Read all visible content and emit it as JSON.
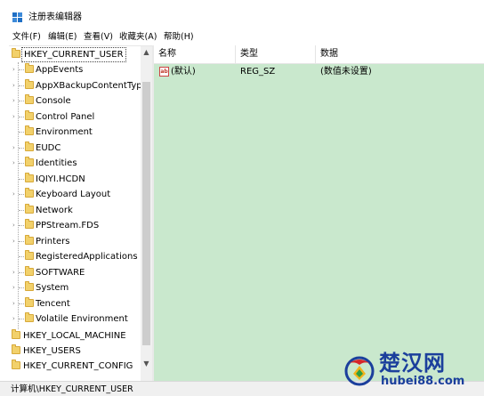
{
  "window": {
    "title": "注册表编辑器"
  },
  "menu": {
    "items": [
      "文件(F)",
      "编辑(E)",
      "查看(V)",
      "收藏夹(A)",
      "帮助(H)"
    ]
  },
  "tree": {
    "root": "HKEY_CURRENT_USER",
    "children": [
      {
        "label": "AppEvents",
        "expandable": true
      },
      {
        "label": "AppXBackupContentType",
        "expandable": true
      },
      {
        "label": "Console",
        "expandable": true
      },
      {
        "label": "Control Panel",
        "expandable": true
      },
      {
        "label": "Environment",
        "expandable": false
      },
      {
        "label": "EUDC",
        "expandable": true
      },
      {
        "label": "Identities",
        "expandable": true
      },
      {
        "label": "IQIYI.HCDN",
        "expandable": false
      },
      {
        "label": "Keyboard Layout",
        "expandable": true
      },
      {
        "label": "Network",
        "expandable": false
      },
      {
        "label": "PPStream.FDS",
        "expandable": true
      },
      {
        "label": "Printers",
        "expandable": true
      },
      {
        "label": "RegisteredApplications",
        "expandable": false
      },
      {
        "label": "SOFTWARE",
        "expandable": true
      },
      {
        "label": "System",
        "expandable": true
      },
      {
        "label": "Tencent",
        "expandable": true
      },
      {
        "label": "Volatile Environment",
        "expandable": true
      }
    ],
    "other_roots": [
      "HKEY_LOCAL_MACHINE",
      "HKEY_USERS",
      "HKEY_CURRENT_CONFIG"
    ],
    "folder_color": "#f2d16b"
  },
  "list": {
    "columns": [
      "名称",
      "类型",
      "数据"
    ],
    "rows": [
      {
        "icon": "ab",
        "name": "(默认)",
        "type": "REG_SZ",
        "data": "(数值未设置)"
      }
    ],
    "background_color": "#c9e8cd"
  },
  "status": {
    "path": "计算机\\HKEY_CURRENT_USER"
  },
  "watermark": {
    "name": "楚汉网",
    "url": "hubei88.com"
  }
}
